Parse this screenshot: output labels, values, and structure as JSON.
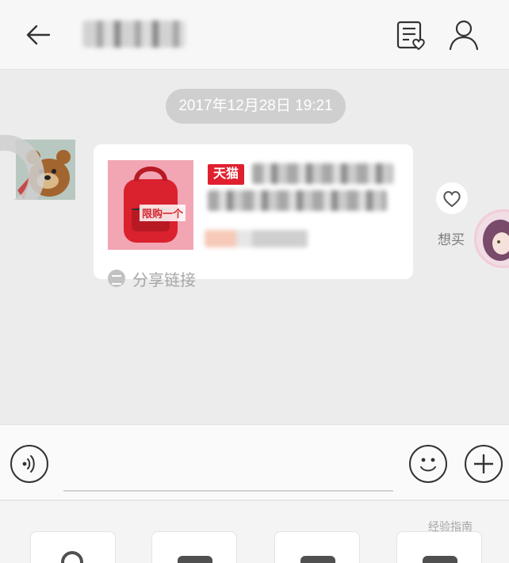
{
  "header": {
    "back_icon": "arrow-left-icon",
    "orders_icon": "list-heart-icon",
    "profile_icon": "person-icon"
  },
  "chat": {
    "timestamp": "2017年12月28日 19:21",
    "product_card": {
      "promo_tag": "限购一个",
      "store_badge": "天猫",
      "share_label": "分享链接"
    },
    "want_label": "想买"
  },
  "composer": {
    "voice_icon": "voice-icon",
    "emoji_icon": "smile-icon",
    "plus_icon": "plus-icon",
    "placeholder": ""
  },
  "watermark": "经验指南",
  "colors": {
    "accent": "#e0202f",
    "timestamp_bg": "#cfcfcf",
    "page_bg": "#ececec"
  }
}
